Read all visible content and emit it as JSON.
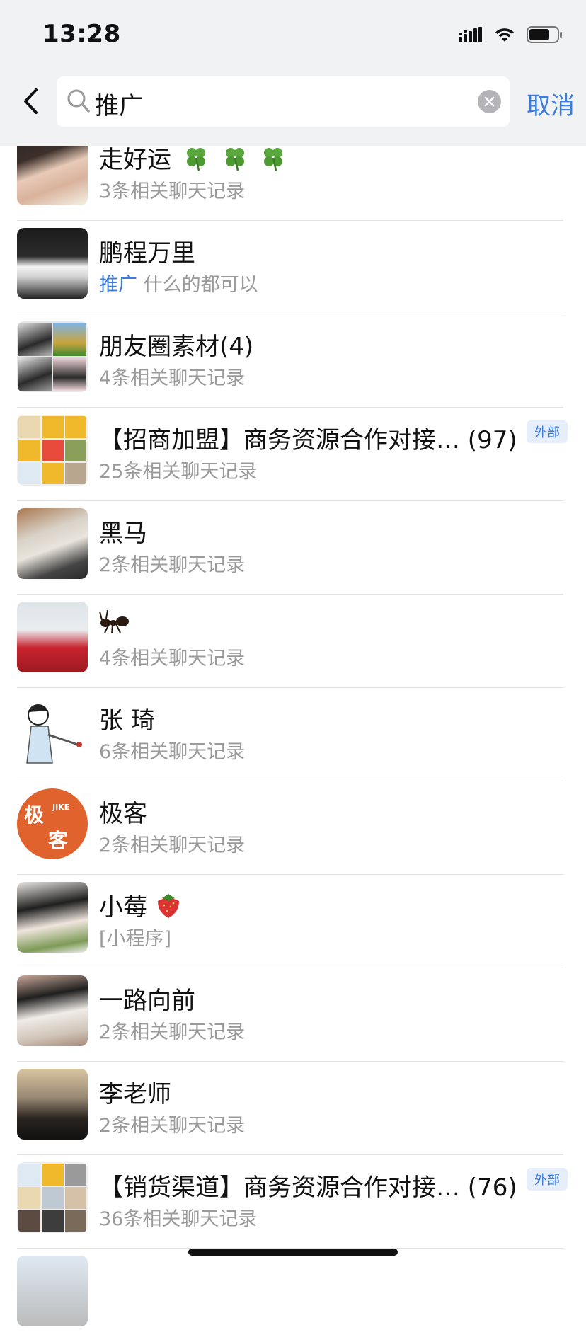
{
  "status_bar": {
    "time": "13:28"
  },
  "search": {
    "query": "推广",
    "cancel_label": "取消"
  },
  "results": [
    {
      "title": "走好运",
      "subtitle": "3条相关聊天记录",
      "emoji": "four-leaf-clover x3"
    },
    {
      "title": "鹏程万里",
      "subtitle_highlight": "推广",
      "subtitle": " 什么的都可以"
    },
    {
      "title": "朋友圈素材(4)",
      "subtitle": "4条相关聊天记录"
    },
    {
      "title": "【招商加盟】商务资源合作对接… (97)",
      "subtitle": "25条相关聊天记录",
      "badge": "外部"
    },
    {
      "title": "黑马",
      "subtitle": "2条相关聊天记录"
    },
    {
      "title": "",
      "subtitle": "4条相关聊天记录",
      "emoji": "ant-emoji"
    },
    {
      "title": "张 琦",
      "subtitle": "6条相关聊天记录"
    },
    {
      "title": "极客",
      "subtitle": "2条相关聊天记录",
      "avatar_text": "极 客",
      "avatar_small_text": "JIKE"
    },
    {
      "title": "小莓",
      "subtitle": "[小程序]",
      "emoji": "strawberry-emoji"
    },
    {
      "title": "一路向前",
      "subtitle": "2条相关聊天记录"
    },
    {
      "title": "李老师",
      "subtitle": "2条相关聊天记录"
    },
    {
      "title": "【销货渠道】商务资源合作对接… (76)",
      "subtitle": "36条相关聊天记录",
      "badge": "外部"
    }
  ],
  "colors": {
    "accent": "#3b7ddb",
    "header_bg": "#f1f2f3",
    "subtitle": "#9a9a9a"
  }
}
